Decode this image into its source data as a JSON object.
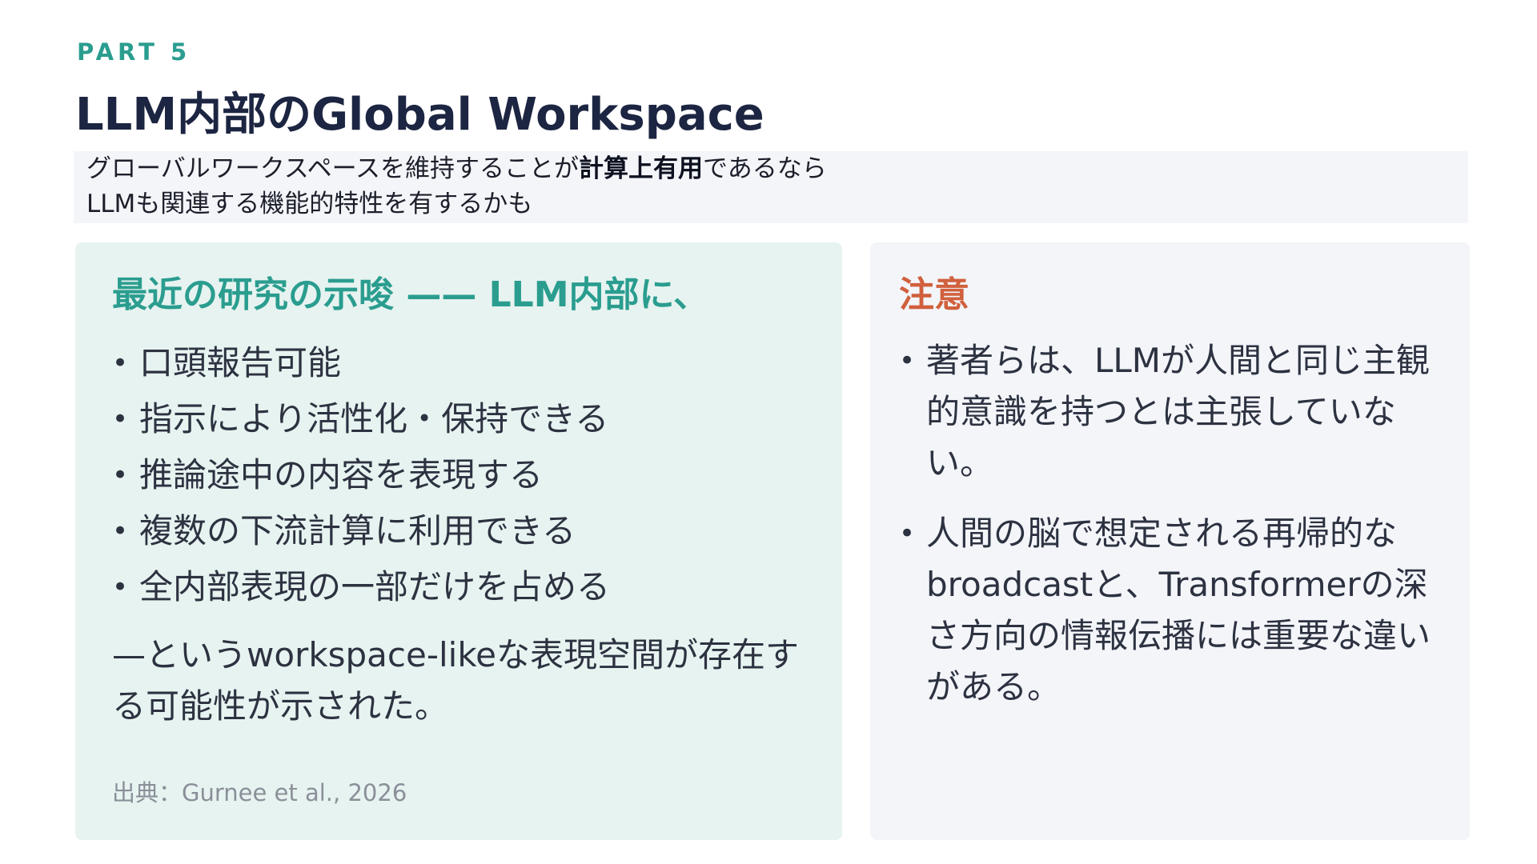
{
  "header": {
    "part_label": "PART 5",
    "title": "LLM内部のGlobal Workspace"
  },
  "intro": {
    "line1_pre": "グローバルワークスペースを維持することが",
    "line1_bold": "計算上有用",
    "line1_post": "であるなら",
    "line2": "LLMも関連する機能的特性を有するかも"
  },
  "left_card": {
    "heading": "最近の研究の示唆 —— LLM内部に、",
    "bullet_symbol": "•",
    "bullets": [
      "口頭報告可能",
      "指示により活性化・保持できる",
      "推論途中の内容を表現する",
      "複数の下流計算に利用できる",
      "全内部表現の一部だけを占める"
    ],
    "summary": "—というworkspace-likeな表現空間が存在する可能性が示された。",
    "source": "出典：Gurnee et al., 2026"
  },
  "right_card": {
    "heading": "注意",
    "bullet_symbol": "•",
    "notes": [
      "著者らは、LLMが人間と同じ主観的意識を持つとは主張していない。",
      "人間の脳で想定される再帰的なbroadcastと、Transformerの深さ方向の情報伝播には重要な違いがある。"
    ]
  },
  "colors": {
    "accent_teal": "#2a9d8f",
    "accent_orange": "#d1603d",
    "title_navy": "#1c2541",
    "left_card_bg": "#e7f3f0",
    "right_card_bg": "#f3f5f9"
  }
}
